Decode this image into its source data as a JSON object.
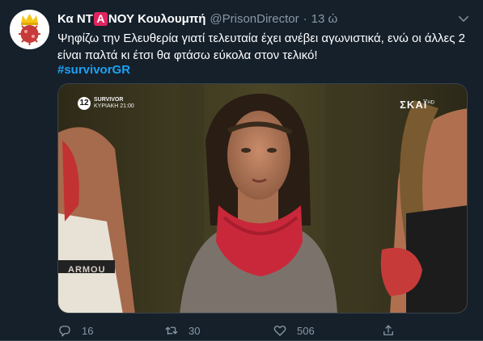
{
  "tweet": {
    "name_prefix": "Κα ΝΤ",
    "name_badge": "Α",
    "name_suffix": "ΝΟΥ Κουλουμπή",
    "handle": "@PrisonDirector",
    "separator": "·",
    "time": "13 ώ",
    "text": "Ψηφίζω την Ελευθερία γιατί τελευταία έχει ανέβει αγωνιστικά, ενώ οι άλλες 2 είναι παλτά κι έτσι θα φτάσω εύκολα στον τελικό!",
    "hashtag": "#survivorGR"
  },
  "media": {
    "channel_number": "12",
    "show_line1": "SURVIVOR",
    "show_line2": "ΚΥΡΙΑΚΗ 21:00",
    "network": "ΣΚΑΪ",
    "network_hd": "HD",
    "apparel": "ARMOU"
  },
  "actions": {
    "replies": "16",
    "retweets": "30",
    "likes": "506"
  },
  "colors": {
    "background": "#15202b",
    "accent": "#1da1f2",
    "muted": "#8899a6",
    "badge": "#e0245e"
  },
  "icons": {
    "avatar": "crowned-virus-avatar",
    "more": "chevron-down-icon",
    "reply": "reply-icon",
    "retweet": "retweet-icon",
    "like": "heart-icon",
    "share": "share-icon"
  }
}
